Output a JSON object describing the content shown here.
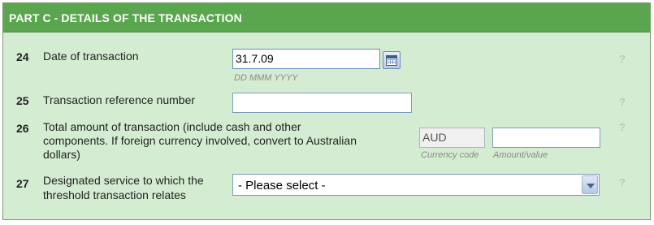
{
  "header": {
    "title": "PART C - DETAILS OF THE TRANSACTION"
  },
  "rows": {
    "r24": {
      "number": "24",
      "label": "Date of transaction",
      "value": "31.7.09",
      "hint": "DD MMM YYYY",
      "calendar_icon": "calendar-icon",
      "help": "?"
    },
    "r25": {
      "number": "25",
      "label": "Transaction reference number",
      "value": "",
      "help": "?"
    },
    "r26": {
      "number": "26",
      "label_line1": "Total amount of transaction (include cash and other",
      "label_line2": "components. If foreign currency involved, convert to Australian",
      "label_line3": "dollars)",
      "currency_value": "AUD",
      "currency_hint": "Currency code",
      "amount_value": "",
      "amount_hint": "Amount/value",
      "help": "?"
    },
    "r27": {
      "number": "27",
      "label_line1": "Designated service to which the",
      "label_line2": "threshold transaction relates",
      "selected": "- Please select -",
      "help": "?"
    }
  },
  "colors": {
    "header_bg": "#5aa64f",
    "panel_bg": "#d4edd2",
    "input_border": "#7f9db9"
  }
}
